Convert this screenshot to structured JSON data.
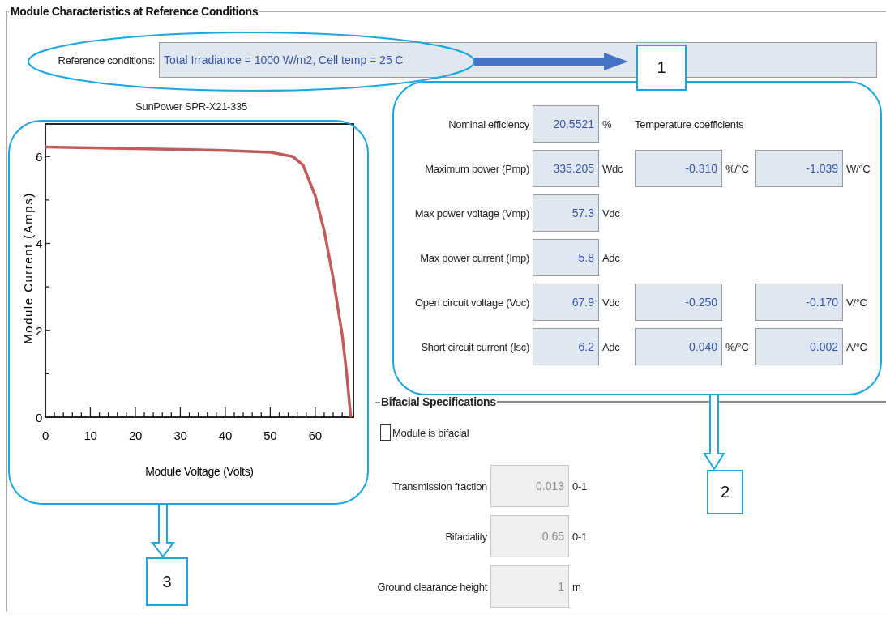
{
  "group": {
    "title": "Module Characteristics at Reference Conditions"
  },
  "reference": {
    "label": "Reference conditions:",
    "value": "Total Irradiance = 1000 W/m2, Cell temp = 25 C"
  },
  "chart": {
    "chart_data": {
      "type": "line",
      "title": "SunPower SPR-X21-335",
      "xlabel": "Module Voltage (Volts)",
      "ylabel": "Module Current (Amps)",
      "x": [
        0,
        10,
        20,
        30,
        40,
        50,
        55,
        57.3,
        60,
        62,
        64,
        66,
        67,
        67.9
      ],
      "series": [
        {
          "color": "#c45a5a",
          "values": [
            6.22,
            6.2,
            6.18,
            6.16,
            6.14,
            6.1,
            6.0,
            5.8,
            5.1,
            4.3,
            3.2,
            1.9,
            1.0,
            0
          ]
        }
      ],
      "xlim": [
        0,
        68.5
      ],
      "ylim": [
        0,
        6.75
      ],
      "xticks": [
        0,
        10,
        20,
        30,
        40,
        50,
        60
      ],
      "yticks": [
        0,
        2,
        4,
        6
      ]
    }
  },
  "parameters": {
    "coef_heading": "Temperature coefficients",
    "rows": [
      {
        "label": "Nominal efficiency",
        "value": "20.5521",
        "unit": "%"
      },
      {
        "label": "Maximum power (Pmp)",
        "value": "335.205",
        "unit": "Wdc",
        "coef_1": "-0.310",
        "coef_1_unit": "%/°C",
        "coef_2": "-1.039",
        "coef_2_unit": "W/°C"
      },
      {
        "label": "Max power voltage (Vmp)",
        "value": "57.3",
        "unit": "Vdc"
      },
      {
        "label": "Max power current (Imp)",
        "value": "5.8",
        "unit": "Adc"
      },
      {
        "label": "Open circuit voltage (Voc)",
        "value": "67.9",
        "unit": "Vdc",
        "coef_1": "-0.250",
        "coef_2": "-0.170",
        "coef_2_unit": "V/°C"
      },
      {
        "label": "Short circuit current (Isc)",
        "value": "6.2",
        "unit": "Adc",
        "coef_1": "0.040",
        "coef_1_unit": "%/°C",
        "coef_2": "0.002",
        "coef_2_unit": "A/°C"
      }
    ]
  },
  "bifacial": {
    "title": "Bifacial Specifications",
    "checkbox": {
      "label": "Module is bifacial",
      "checked": false
    },
    "fields": [
      {
        "label": "Transmission fraction",
        "value": "0.013",
        "unit": "0-1",
        "disabled": true
      },
      {
        "label": "Bifaciality",
        "value": "0.65",
        "unit": "0-1",
        "disabled": true
      },
      {
        "label": "Ground clearance height",
        "value": "1",
        "unit": "m",
        "disabled": true
      }
    ]
  },
  "callouts": [
    {
      "label": "1"
    },
    {
      "label": "2"
    },
    {
      "label": "3"
    }
  ]
}
